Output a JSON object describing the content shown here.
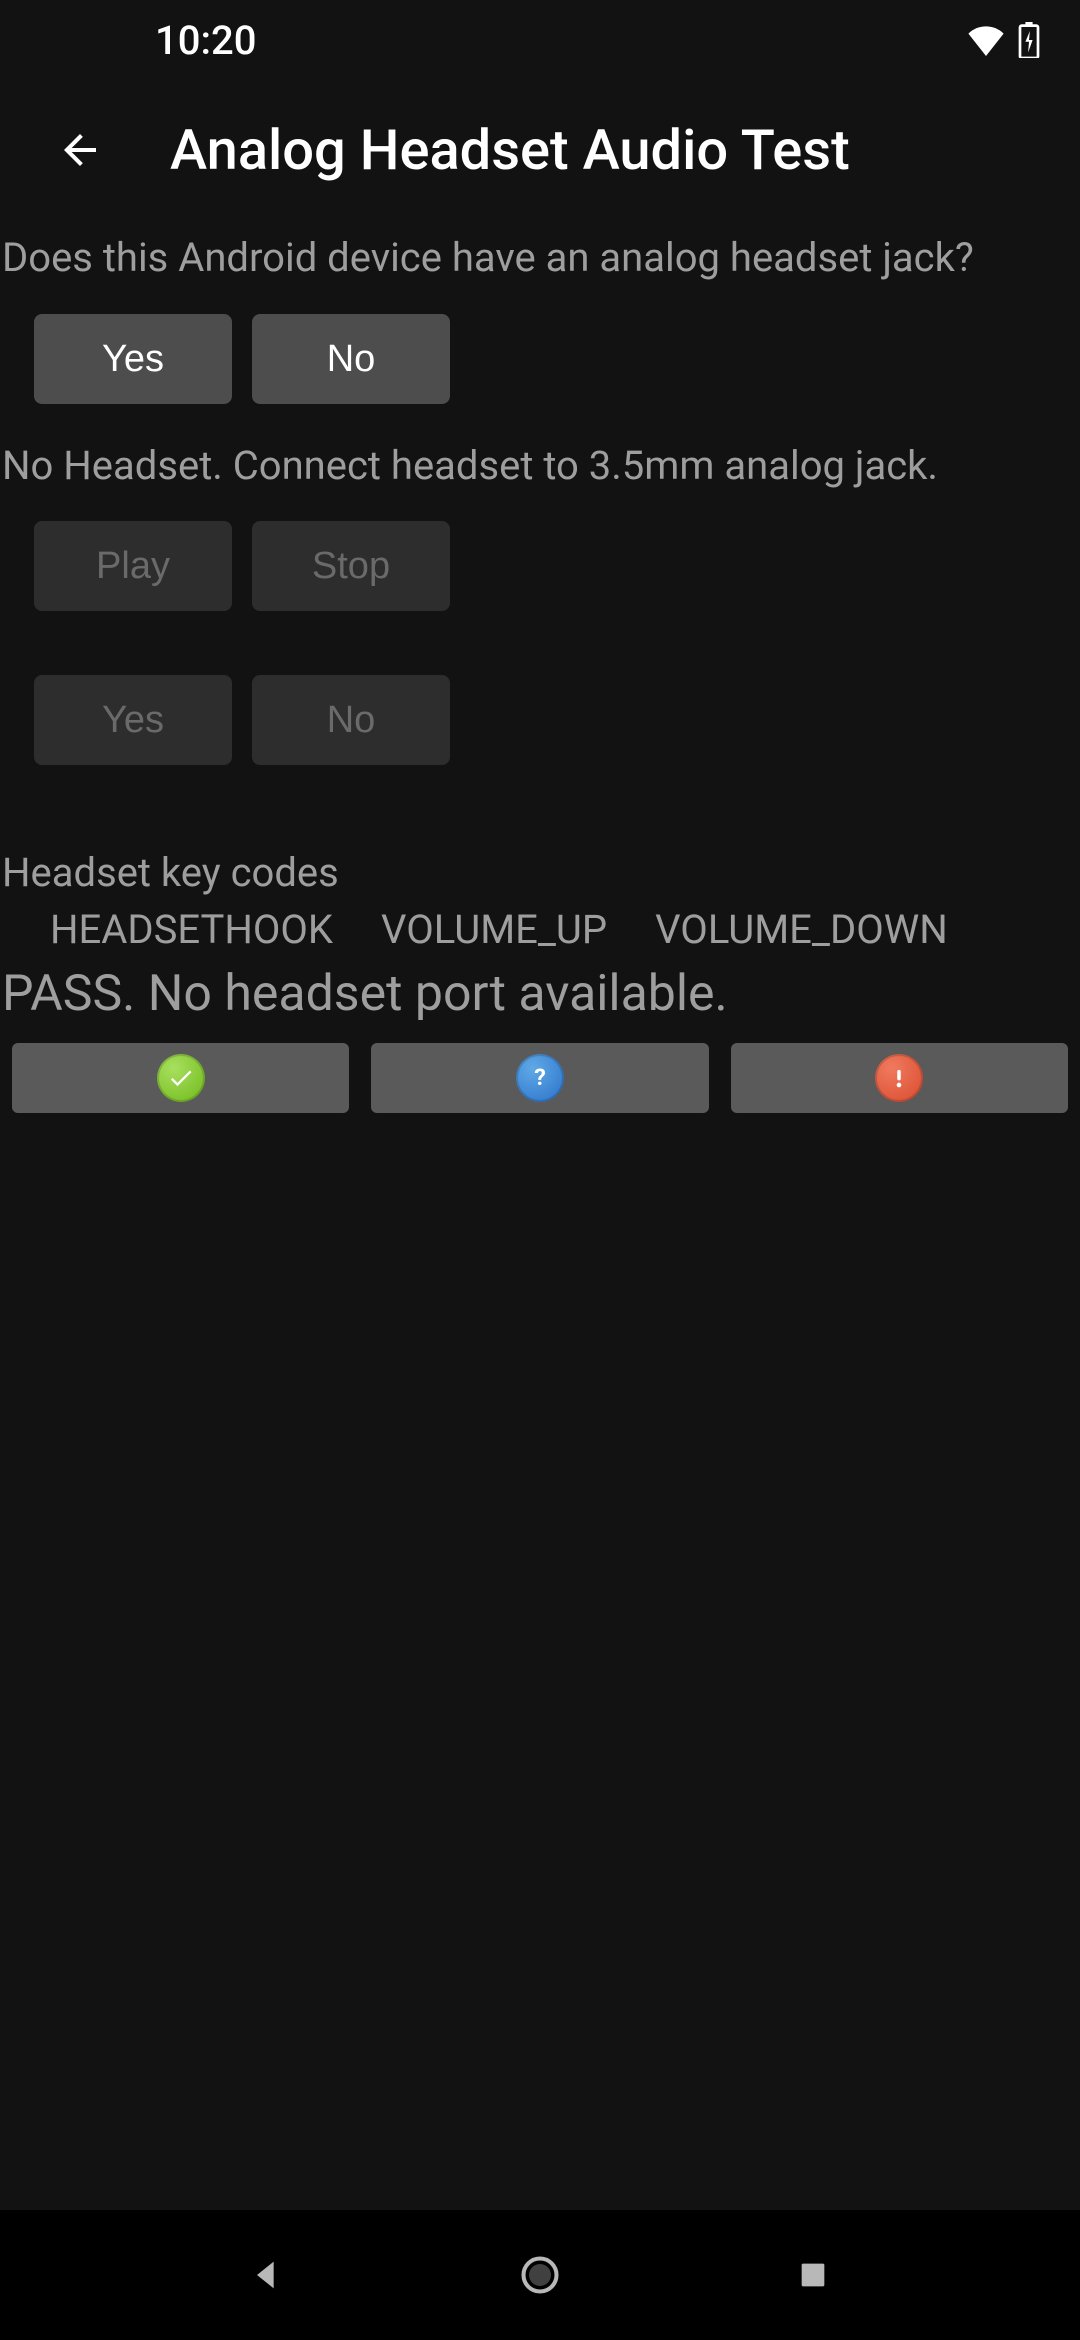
{
  "status_bar": {
    "time": "10:20"
  },
  "app_bar": {
    "title": "Analog Headset Audio Test"
  },
  "question1": {
    "text": "Does this Android device have an analog headset jack?",
    "yes": "Yes",
    "no": "No"
  },
  "headset_status": "No Headset. Connect headset to 3.5mm analog jack.",
  "playback": {
    "play": "Play",
    "stop": "Stop"
  },
  "confirm": {
    "yes": "Yes",
    "no": "No"
  },
  "keycodes": {
    "label": "Headset key codes",
    "items": [
      "HEADSETHOOK",
      "VOLUME_UP",
      "VOLUME_DOWN"
    ]
  },
  "result": "PASS. No headset port available."
}
